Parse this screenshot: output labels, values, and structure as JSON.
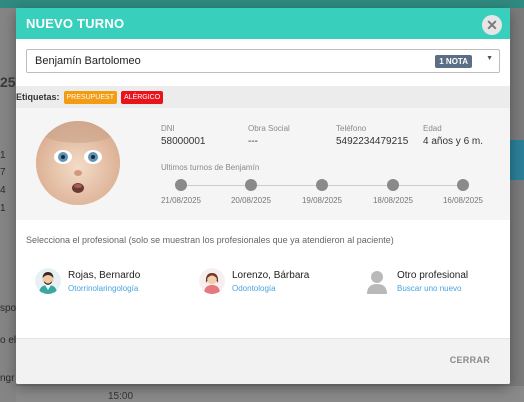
{
  "background": {
    "left_numbers": [
      "25",
      "1",
      "7",
      "4",
      "1"
    ],
    "side_text": [
      "spo",
      "o el",
      "ngr"
    ],
    "time": "15:00"
  },
  "modal": {
    "title": "NUEVO TURNO",
    "close_icon": "close-icon",
    "patient_select": {
      "value": "Benjamín Bartolomeo",
      "badge": "1 NOTA"
    },
    "tags": {
      "label": "Etiquetas:",
      "items": [
        {
          "label": "PRESUPUEST",
          "color": "#f39c12"
        },
        {
          "label": "ALÉRGICO",
          "color": "#e8141a"
        }
      ]
    },
    "patient": {
      "fields": [
        {
          "label": "DNI",
          "value": "58000001"
        },
        {
          "label": "Obra Social",
          "value": "---"
        },
        {
          "label": "Teléfono",
          "value": "5492234479215"
        },
        {
          "label": "Edad",
          "value": "4 años y 6 m."
        }
      ],
      "timeline_label": "Ultimos turnos de Benjamín",
      "timeline_dates": [
        "21/08/2025",
        "20/08/2025",
        "19/08/2025",
        "18/08/2025",
        "16/08/2025"
      ]
    },
    "professional_prompt": "Selecciona el profesional (solo se muestran los profesionales que ya atendieron al paciente)",
    "professionals": [
      {
        "name": "Rojas, Bernardo",
        "specialty": "Otorrinolaringología"
      },
      {
        "name": "Lorenzo, Bárbara",
        "specialty": "Odontología"
      },
      {
        "name": "Otro profesional",
        "specialty": "Buscar uno nuevo"
      }
    ],
    "footer": {
      "close_label": "CERRAR"
    }
  },
  "colors": {
    "header": "#38cfbd",
    "link": "#4aa3df",
    "badge": "#5a6f86"
  }
}
